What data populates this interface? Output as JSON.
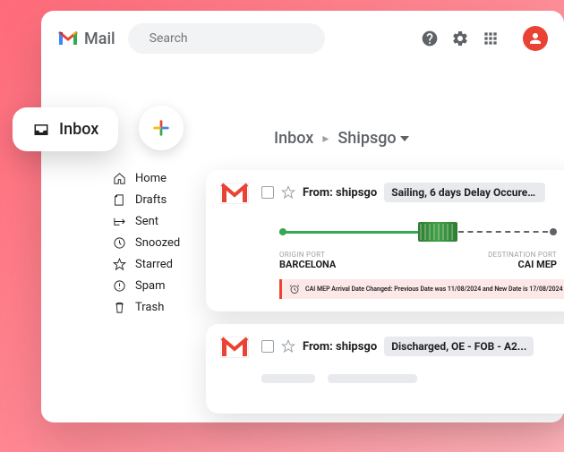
{
  "header": {
    "app_name": "Mail",
    "search_placeholder": "Search"
  },
  "inbox_pill": {
    "label": "Inbox"
  },
  "breadcrumb": {
    "root": "Inbox",
    "current": "Shipsgo"
  },
  "sidebar": {
    "items": [
      {
        "label": "Home"
      },
      {
        "label": "Drafts"
      },
      {
        "label": "Sent"
      },
      {
        "label": "Snoozed"
      },
      {
        "label": "Starred"
      },
      {
        "label": "Spam"
      },
      {
        "label": "Trash"
      }
    ]
  },
  "emails": [
    {
      "from_prefix": "From: ",
      "from": "shipsgo",
      "subject": "Sailing, 6 days Delay Occured...",
      "origin_label": "ORIGIN PORT",
      "origin_port": "BARCELONA",
      "dest_label": "DESTINATION PORT",
      "dest_port": "CAI MEP",
      "alert": "CAI MEP Arrival Date Changed: Previous Date was 11/08/2024 and New Date is 17/08/2024"
    },
    {
      "from_prefix": "From: ",
      "from": "shipsgo",
      "subject": "Discharged, OE - FOB - A2..."
    }
  ]
}
